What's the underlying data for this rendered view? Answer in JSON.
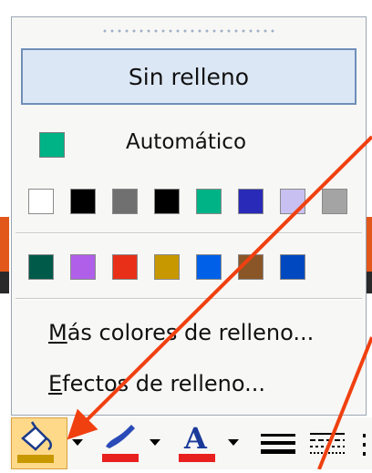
{
  "menu": {
    "no_fill_label": "Sin relleno",
    "automatic_label": "Automático",
    "automatic_color": "#00b386",
    "more_colors": {
      "mnemonic": "M",
      "rest": "ás colores de relleno..."
    },
    "fill_effects": {
      "mnemonic": "E",
      "rest": "fectos de relleno..."
    }
  },
  "swatches_row1": [
    "#ffffff",
    "#000000",
    "#707070",
    "#000000",
    "#00b386",
    "#2a2ab8",
    "#c8c0f0",
    "#a4a4a4"
  ],
  "swatches_row2": [
    "#005a4a",
    "#b060e8",
    "#e83018",
    "#c89800",
    "#0060e8",
    "#8a5628",
    "#0048c0"
  ],
  "toolbar": {
    "fill_color_button": "paint-bucket-icon",
    "fill_color_bar": "#c89800",
    "line_color_button": "paintbrush-icon",
    "line_color_bar": "#e82020",
    "font_color_button": "font-color-icon",
    "font_color_letter": "A",
    "font_color_bar": "#e82020",
    "line_style_button": "line-style-icon",
    "dash_style_button": "dash-style-icon",
    "arrow_style_button": "arrow-style-icon"
  },
  "annotation_color": "#f04010"
}
